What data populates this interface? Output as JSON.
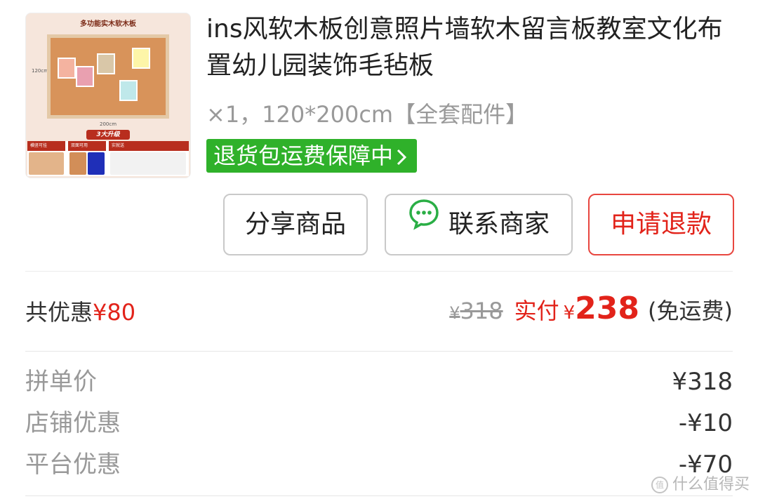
{
  "product": {
    "image_caption": "多功能实木软木板",
    "image_side_label": "120cm",
    "image_bottom_label": "200cm",
    "image_badge": "3大升级",
    "image_features": [
      "横竖可挂",
      "双面可用",
      "实就送"
    ],
    "title": "ins风软木板创意照片墙软木留言板教室文化布置幼儿园装饰毛毡板",
    "spec": "×1，120*200cm【全套配件】",
    "guarantee": "退货包运费保障中"
  },
  "actions": {
    "share": "分享商品",
    "contact": "联系商家",
    "refund": "申请退款"
  },
  "summary": {
    "discount_label": "共优惠",
    "discount_amount": "¥80",
    "original_currency": "¥",
    "original_price": "318",
    "paid_label": "实付",
    "paid_currency": "¥",
    "paid_amount": "238",
    "shipping_note": "(免运费)"
  },
  "breakdown": [
    {
      "label": "拼单价",
      "value": "¥318"
    },
    {
      "label": "店铺优惠",
      "value": "-¥10"
    },
    {
      "label": "平台优惠",
      "value": "-¥70"
    }
  ],
  "watermark": "什么值得买",
  "colors": {
    "accent_red": "#e2231a",
    "guarantee_green": "#2fb12a",
    "wechat_green": "#2aae45"
  }
}
